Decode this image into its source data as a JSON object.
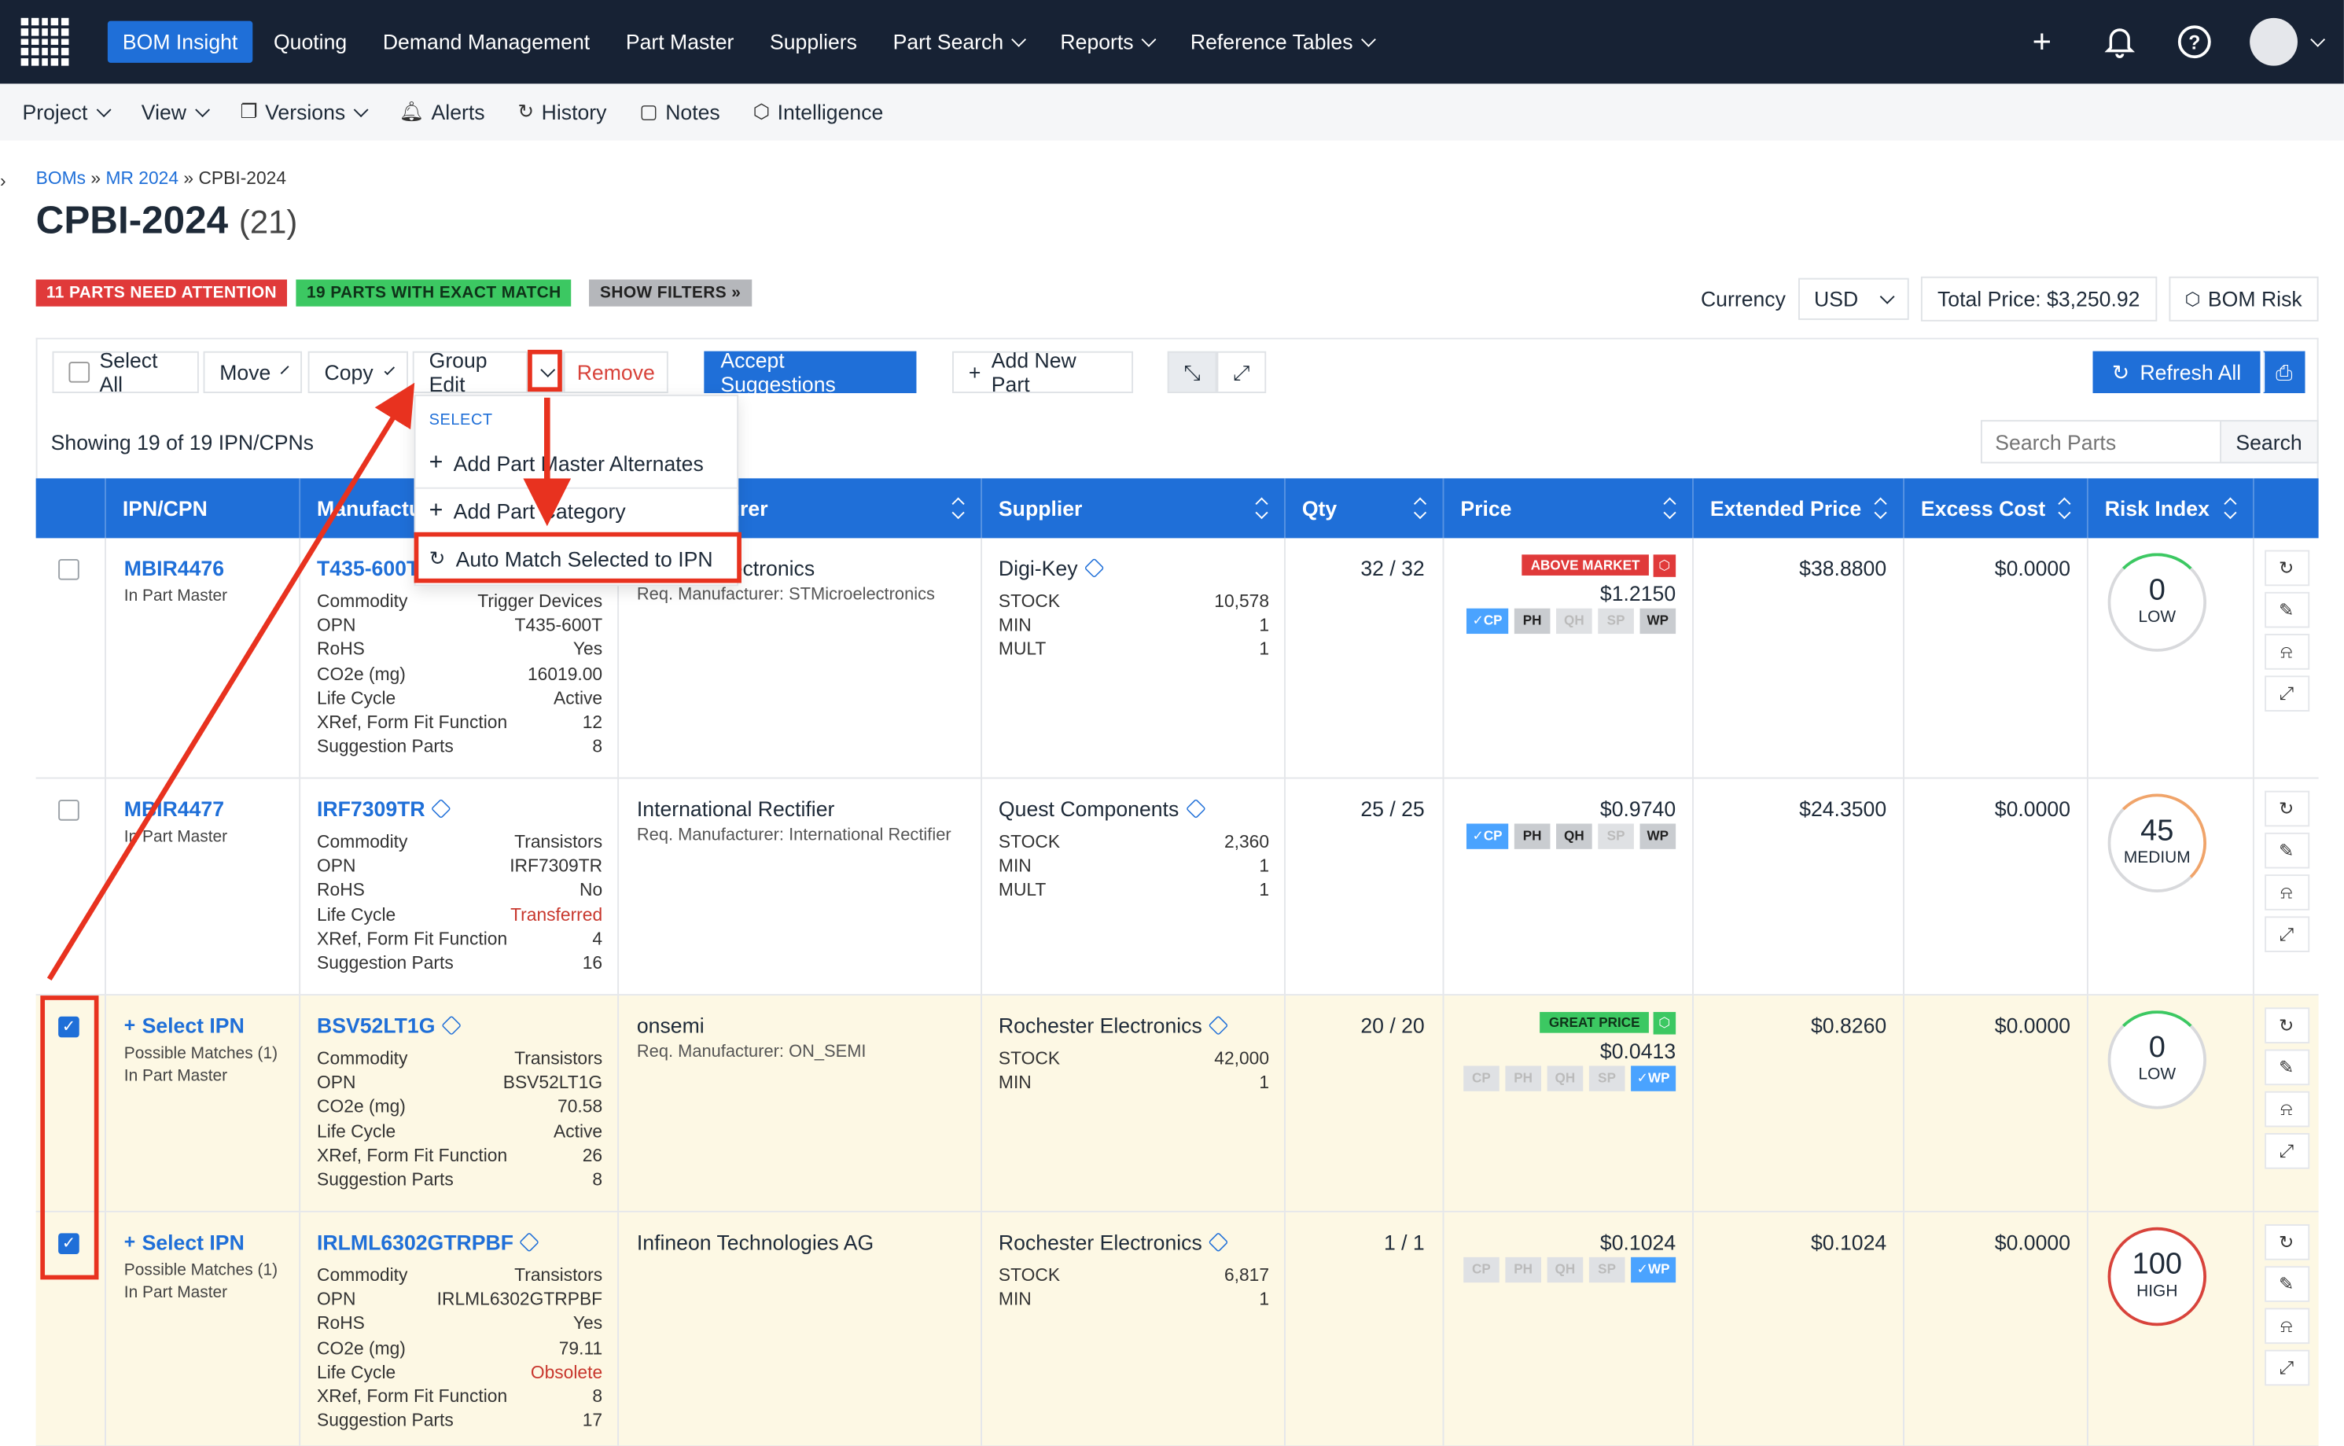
{
  "topnav": {
    "items": [
      {
        "label": "BOM Insight",
        "active": true,
        "caret": false
      },
      {
        "label": "Quoting",
        "caret": false
      },
      {
        "label": "Demand Management",
        "caret": false
      },
      {
        "label": "Part Master",
        "caret": false
      },
      {
        "label": "Suppliers",
        "caret": false
      },
      {
        "label": "Part Search",
        "caret": true
      },
      {
        "label": "Reports",
        "caret": true
      },
      {
        "label": "Reference Tables",
        "caret": true
      }
    ],
    "icons": [
      "plus-icon",
      "bell-icon",
      "help-icon",
      "avatar"
    ]
  },
  "subnav": {
    "project": "Project",
    "view": "View",
    "versions": "Versions",
    "alerts": "Alerts",
    "history": "History",
    "notes": "Notes",
    "intelligence": "Intelligence"
  },
  "breadcrumb": {
    "bom": "BOMs",
    "sep1": "»",
    "mr": "MR 2024",
    "sep2": "»",
    "current": "CPBI-2024"
  },
  "page": {
    "title": "CPBI-2024",
    "count": "(21)"
  },
  "badges": {
    "attention": "11 PARTS NEED ATTENTION",
    "exact": "19 PARTS WITH EXACT MATCH",
    "filters": "SHOW FILTERS »"
  },
  "currency": {
    "label": "Currency",
    "value": "USD",
    "total": "Total Price: $3,250.92",
    "bom_risk": "BOM Risk"
  },
  "toolbar": {
    "select_all": "Select All",
    "move": "Move",
    "copy": "Copy",
    "group_edit": "Group Edit",
    "remove": "Remove",
    "accept": "Accept Suggestions",
    "add_new": "Add New Part",
    "refresh_all": "Refresh All"
  },
  "dropdown": {
    "header": "SELECT",
    "items": [
      "Add Part Master Alternates",
      "Add Part Category",
      "Auto Match Selected to IPN"
    ]
  },
  "showing": "Showing 19 of 19 IPN/CPNs",
  "search": {
    "placeholder": "Search Parts",
    "button": "Search"
  },
  "columns": [
    "IPN/CPN",
    "Manufacturer Part",
    "Manufacturer",
    "Supplier",
    "Qty",
    "Price",
    "Extended Price",
    "Excess Cost",
    "Risk Index"
  ],
  "rows": [
    {
      "checked": false,
      "ipn": "MBIR4476",
      "ipn_sub": "In Part Master",
      "ipn_sub2": "",
      "mpn": "T435-600T",
      "attrs": [
        [
          "Commodity",
          "Trigger Devices"
        ],
        [
          "OPN",
          "T435-600T"
        ],
        [
          "RoHS",
          "Yes"
        ],
        [
          "CO2e (mg)",
          "16019.00"
        ],
        [
          "Life Cycle",
          "Active"
        ],
        [
          "XRef, Form Fit Function",
          "12"
        ],
        [
          "Suggestion Parts",
          "8"
        ]
      ],
      "mfr": "STMicroelectronics",
      "mfr_req": "Req. Manufacturer: STMicroelectronics",
      "supplier": "Digi-Key",
      "stock": [
        [
          "STOCK",
          "10,578"
        ],
        [
          "MIN",
          "1"
        ],
        [
          "MULT",
          "1"
        ]
      ],
      "qty": "32 / 32",
      "price_tag": "ABOVE MARKET",
      "price": "$1.2150",
      "ext": "$38.8800",
      "excess": "$0.0000",
      "risk": "0",
      "risk_level": "LOW"
    },
    {
      "checked": false,
      "ipn": "MBIR4477",
      "ipn_sub": "In Part Master",
      "ipn_sub2": "",
      "mpn": "IRF7309TR",
      "attrs": [
        [
          "Commodity",
          "Transistors"
        ],
        [
          "OPN",
          "IRF7309TR"
        ],
        [
          "RoHS",
          "No"
        ],
        [
          "Life Cycle",
          "Transferred"
        ],
        [
          "XRef, Form Fit Function",
          "4"
        ],
        [
          "Suggestion Parts",
          "16"
        ]
      ],
      "mfr": "International Rectifier",
      "mfr_req": "Req. Manufacturer: International Rectifier",
      "supplier": "Quest Components",
      "stock": [
        [
          "STOCK",
          "2,360"
        ],
        [
          "MIN",
          "1"
        ],
        [
          "MULT",
          "1"
        ]
      ],
      "qty": "25 / 25",
      "price_tag": "",
      "price": "$0.9740",
      "ext": "$24.3500",
      "excess": "$0.0000",
      "risk": "45",
      "risk_level": "MEDIUM"
    },
    {
      "checked": true,
      "ipn": "Select IPN",
      "ipn_sub": "Possible Matches (1)",
      "ipn_sub2": "In Part Master",
      "mpn": "BSV52LT1G",
      "attrs": [
        [
          "Commodity",
          "Transistors"
        ],
        [
          "OPN",
          "BSV52LT1G"
        ],
        [
          "CO2e (mg)",
          "70.58"
        ],
        [
          "Life Cycle",
          "Active"
        ],
        [
          "XRef, Form Fit Function",
          "26"
        ],
        [
          "Suggestion Parts",
          "8"
        ]
      ],
      "mfr": "onsemi",
      "mfr_req": "Req. Manufacturer: ON_SEMI",
      "supplier": "Rochester Electronics",
      "stock": [
        [
          "STOCK",
          "42,000"
        ],
        [
          "MIN",
          "1"
        ]
      ],
      "qty": "20 / 20",
      "price_tag": "GREAT PRICE",
      "price": "$0.0413",
      "ext": "$0.8260",
      "excess": "$0.0000",
      "risk": "0",
      "risk_level": "LOW"
    },
    {
      "checked": true,
      "ipn": "Select IPN",
      "ipn_sub": "Possible Matches (1)",
      "ipn_sub2": "In Part Master",
      "mpn": "IRLML6302GTRPBF",
      "attrs": [
        [
          "Commodity",
          "Transistors"
        ],
        [
          "OPN",
          "IRLML6302GTRPBF"
        ],
        [
          "RoHS",
          "Yes"
        ],
        [
          "CO2e (mg)",
          "79.11"
        ],
        [
          "Life Cycle",
          "Obsolete"
        ],
        [
          "XRef, Form Fit Function",
          "8"
        ],
        [
          "Suggestion Parts",
          "17"
        ]
      ],
      "mfr": "Infineon Technologies AG",
      "mfr_req": "",
      "supplier": "Rochester Electronics",
      "stock": [
        [
          "STOCK",
          "6,817"
        ],
        [
          "MIN",
          "1"
        ]
      ],
      "qty": "1 / 1",
      "price_tag": "",
      "price": "$0.1024",
      "ext": "$0.1024",
      "excess": "$0.0000",
      "risk": "100",
      "risk_level": "HIGH"
    }
  ],
  "pill_labels": [
    "CP",
    "PH",
    "QH",
    "SP",
    "WP"
  ],
  "colors": {
    "nav_bg": "#172234",
    "accent": "#1f6fd8",
    "danger": "#e03a3a",
    "success": "#3cc862",
    "annotation": "#e8321f",
    "selected_row": "#fdf8e4"
  }
}
